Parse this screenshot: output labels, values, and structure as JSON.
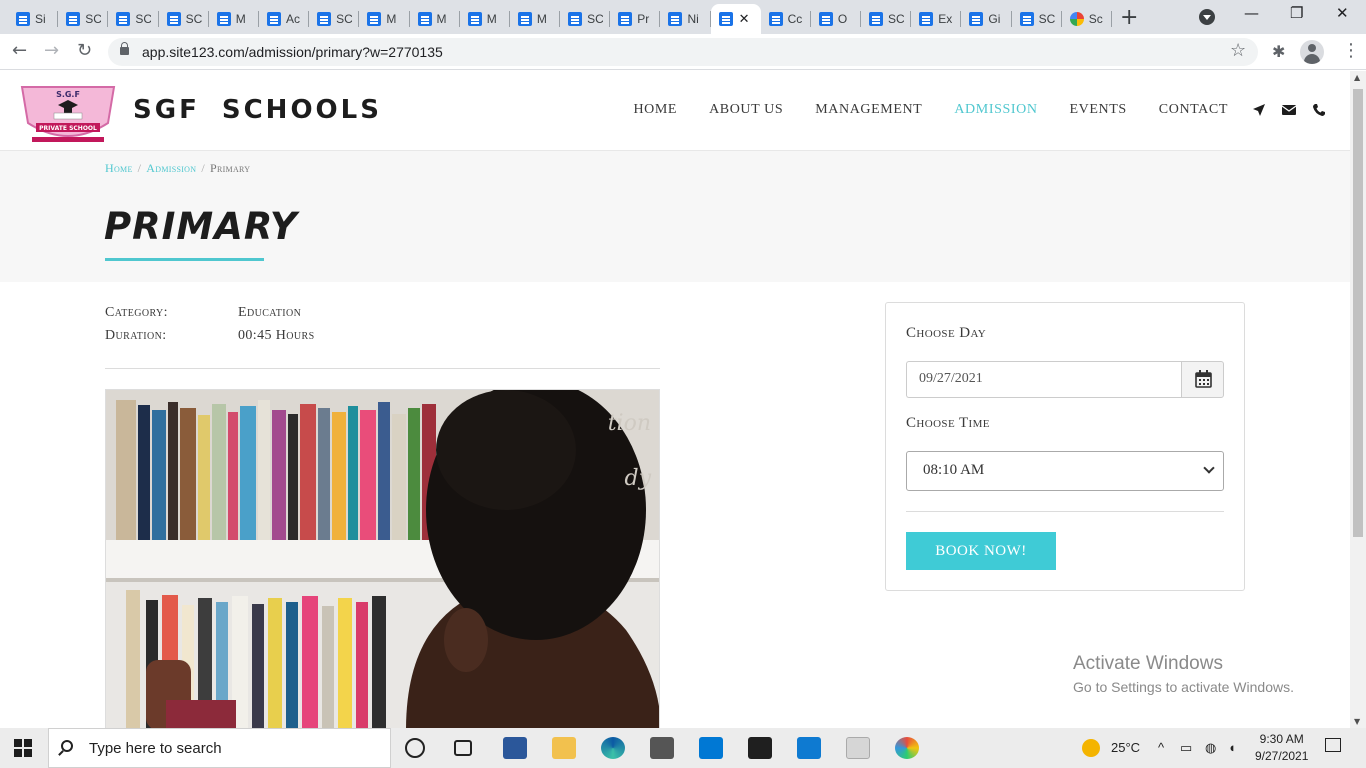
{
  "browser": {
    "tabs": [
      {
        "label": "Si",
        "icon": "docs-icon"
      },
      {
        "label": "SC",
        "icon": "docs-icon"
      },
      {
        "label": "SC",
        "icon": "docs-icon"
      },
      {
        "label": "SC",
        "icon": "docs-icon"
      },
      {
        "label": "M",
        "icon": "docs-icon"
      },
      {
        "label": "Ac",
        "icon": "docs-icon"
      },
      {
        "label": "SC",
        "icon": "docs-icon"
      },
      {
        "label": "M",
        "icon": "docs-icon"
      },
      {
        "label": "M",
        "icon": "docs-icon"
      },
      {
        "label": "M",
        "icon": "docs-icon"
      },
      {
        "label": "M",
        "icon": "docs-icon"
      },
      {
        "label": "SC",
        "icon": "docs-icon"
      },
      {
        "label": "Pr",
        "icon": "docs-icon"
      },
      {
        "label": "Ni",
        "icon": "docs-icon"
      },
      {
        "label": "",
        "icon": "docs-icon",
        "active": true
      },
      {
        "label": "Cc",
        "icon": "docs-icon"
      },
      {
        "label": "O",
        "icon": "docs-icon"
      },
      {
        "label": "SC",
        "icon": "docs-icon"
      },
      {
        "label": "Ex",
        "icon": "docs-icon"
      },
      {
        "label": "Gi",
        "icon": "docs-icon"
      },
      {
        "label": "SC",
        "icon": "docs-icon"
      },
      {
        "label": "Sc",
        "icon": "colorful-icon"
      }
    ],
    "url": "app.site123.com/admission/primary?w=2770135"
  },
  "site": {
    "brand": "SGF SCHOOLS",
    "logo_text": {
      "top": "S.G.F",
      "ribbon": "PRIVATE SCHOOL"
    },
    "nav": [
      {
        "label": "HOME"
      },
      {
        "label": "ABOUT US"
      },
      {
        "label": "MANAGEMENT"
      },
      {
        "label": "ADMISSION",
        "active": true
      },
      {
        "label": "EVENTS"
      },
      {
        "label": "CONTACT"
      }
    ],
    "nav_icons": [
      "location-arrow-icon",
      "envelope-icon",
      "phone-icon"
    ],
    "accent_color": "#4fc7cf"
  },
  "page": {
    "breadcrumb": {
      "home": "Home",
      "admission": "Admission",
      "current": "Primary",
      "separator": "/"
    },
    "title": "PRIMARY",
    "meta": [
      {
        "key": "Category:",
        "value": "Education"
      },
      {
        "key": "Duration:",
        "value": "00:45 Hours"
      }
    ]
  },
  "booking": {
    "day_label": "Choose Day",
    "day_value": "09/27/2021",
    "time_label": "Choose Time",
    "time_value": "08:10 AM",
    "button": "BOOK NOW!"
  },
  "watermark": {
    "line1": "Activate Windows",
    "line2": "Go to Settings to activate Windows."
  },
  "taskbar": {
    "search_placeholder": "Type here to search",
    "weather_temp": "25°C",
    "time": "9:30 AM",
    "date": "9/27/2021"
  }
}
